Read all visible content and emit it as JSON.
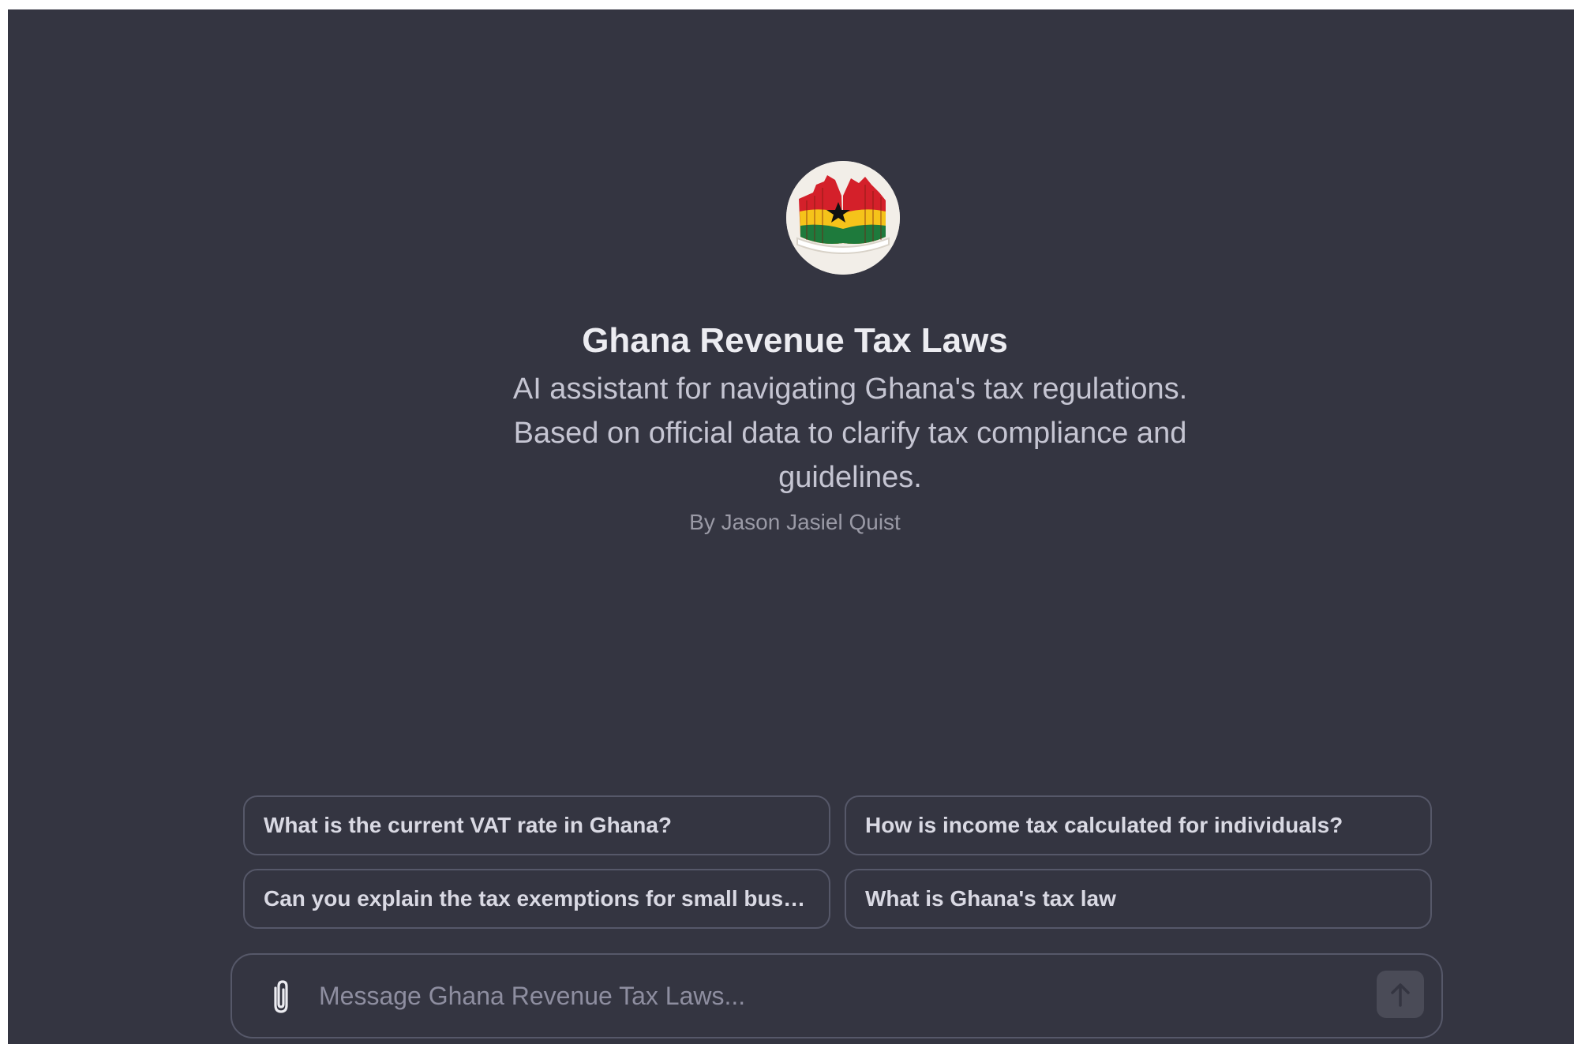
{
  "gpt": {
    "name": "Ghana Revenue Tax Laws",
    "description": "AI assistant for navigating Ghana's tax regulations. Based on official data to clarify tax compliance and guidelines.",
    "author": "By Jason Jasiel Quist",
    "avatar_icon": "ghana-flag-book-icon"
  },
  "suggestions": [
    "What is the current VAT rate in Ghana?",
    "How is income tax calculated for individuals?",
    "Can you explain the tax exemptions for small businesses?",
    "What is Ghana's tax law"
  ],
  "composer": {
    "placeholder": "Message Ghana Revenue Tax Laws...",
    "value": "",
    "attach_icon": "paperclip-icon",
    "send_icon": "arrow-up-icon"
  },
  "colors": {
    "background": "#343541",
    "border": "#565869",
    "title": "#ececf1",
    "description": "#c5c5d2",
    "muted": "#9a9aa6"
  }
}
